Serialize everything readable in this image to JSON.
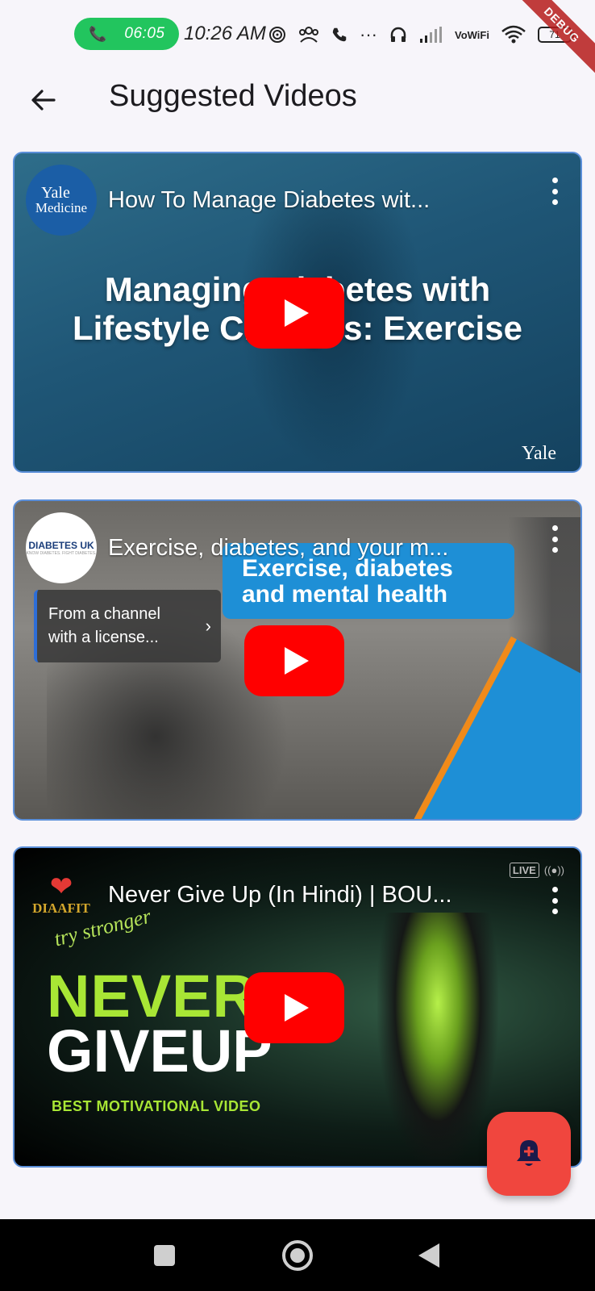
{
  "status_bar": {
    "call_time": "06:05",
    "clock": "10:26 AM",
    "vowifi_line1": "Vo",
    "vowifi_line2": "WiFi",
    "battery": "71",
    "debug_banner": "DEBUG",
    "call_color": "#22c55e"
  },
  "app_bar": {
    "title": "Suggested Videos"
  },
  "videos": [
    {
      "channel_line1": "Yale",
      "channel_line2": "Medicine",
      "title": "How To Manage Diabetes wit...",
      "thumb_line1": "Managing Diabetes with",
      "thumb_line2": "Lifestyle Changes: Exercise",
      "watermark": "Yale"
    },
    {
      "channel_line1": "DIABETES UK",
      "channel_line2": "KNOW DIABETES. FIGHT DIABETES.",
      "title": "Exercise, diabetes, and your m...",
      "banner_line1": "Exercise, diabetes",
      "banner_line2": "and mental health",
      "license_line1": "From a channel",
      "license_line2": "with a license..."
    },
    {
      "channel_name": "DIAAFIT",
      "title": "Never Give Up (In Hindi) | BOU...",
      "script_text": "try stronger",
      "live_label": "LIVE",
      "headline1": "NEVER",
      "headline2": "GIVEUP",
      "subheadline": "BEST MOTIVATIONAL VIDEO"
    }
  ],
  "colors": {
    "youtube_red": "#ff0000",
    "fab": "#f0463e",
    "card_border": "#5b8fd9"
  },
  "icons": {
    "back": "arrow-left",
    "more": "more-vertical",
    "play": "youtube-play",
    "fab": "notification-add",
    "nav": [
      "square",
      "circle",
      "triangle-left"
    ]
  }
}
